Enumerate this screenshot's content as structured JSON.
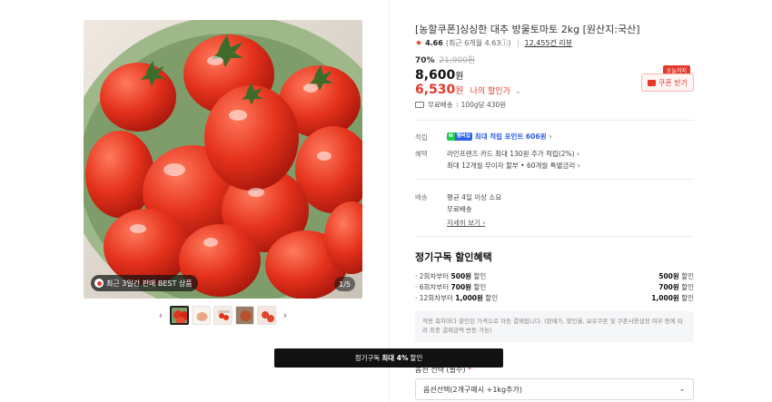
{
  "gallery": {
    "best_badge": "최근 3일간 판매 BEST 상품",
    "counter": "1/5",
    "prev_arrow": "‹",
    "next_arrow": "›"
  },
  "product": {
    "title": "[농할쿠폰]싱싱한 대추 방울토마토 2kg [원산지:국산]",
    "rating_star": "★",
    "rating": "4.66",
    "rating_detail": "(최근 6개월 4.63ⓘ)",
    "review_count": "12,455건 리뷰",
    "discount_rate": "70%",
    "original_price": "21,900원",
    "price": "8,600",
    "price_unit": "원",
    "my_price": "6,530",
    "my_price_unit": "원",
    "my_price_label": "나의 할인가",
    "my_price_chevron": "⌄"
  },
  "coupon": {
    "tag": "오늘까지",
    "button_label": "쿠폰 받기"
  },
  "shipping_summary": {
    "free": "무료배송",
    "unit_price": "100g당 430원"
  },
  "info": {
    "points_label": "적립",
    "npay_n": "N",
    "npay_pay": "멤버십",
    "points_text": "최대 적립 포인트 606원",
    "points_chevron": "›",
    "benefit_label": "혜택",
    "benefit_line1": "라인프렌즈 카드 최대 130원 추가 적립(2%) ›",
    "benefit_line2": "최대 12개월 무이자 할부 • 60개월 특별금리 ›",
    "delivery_label": "배송",
    "delivery_line1": "평균 4일 이상 소요",
    "delivery_line2": "무료배송",
    "delivery_more": "자세히 보기 ›"
  },
  "subscription": {
    "title": "정기구독 할인혜택",
    "rows": [
      {
        "pre": "· 2회차부터 ",
        "bold": "500원",
        "post": " 할인",
        "amount": "500원",
        "amount_suffix": " 할인"
      },
      {
        "pre": "· 6회차부터 ",
        "bold": "700원",
        "post": " 할인",
        "amount": "700원",
        "amount_suffix": " 할인"
      },
      {
        "pre": "· 12회차부터 ",
        "bold": "1,000원",
        "post": " 할인",
        "amount": "1,000원",
        "amount_suffix": " 할인"
      }
    ],
    "notice": "적용 회차마다 할인된 가격으로 자동 결제됩니다. (판매가, 할인율, 보유쿠폰 및 쿠폰사용설정 여부 등에 따라 최종 결제금액 변동 가능)"
  },
  "toast": {
    "pre": "정기구독",
    "bold": "최대 4%",
    "post": "할인"
  },
  "options": {
    "label": "옵션 선택 (필수)",
    "required_mark": "*",
    "selected": "옵션선택(2개구매시 +1kg추가)",
    "chevron": "⌄"
  },
  "colors": {
    "accent": "#e4392b",
    "points_blue": "#2d5be3"
  }
}
